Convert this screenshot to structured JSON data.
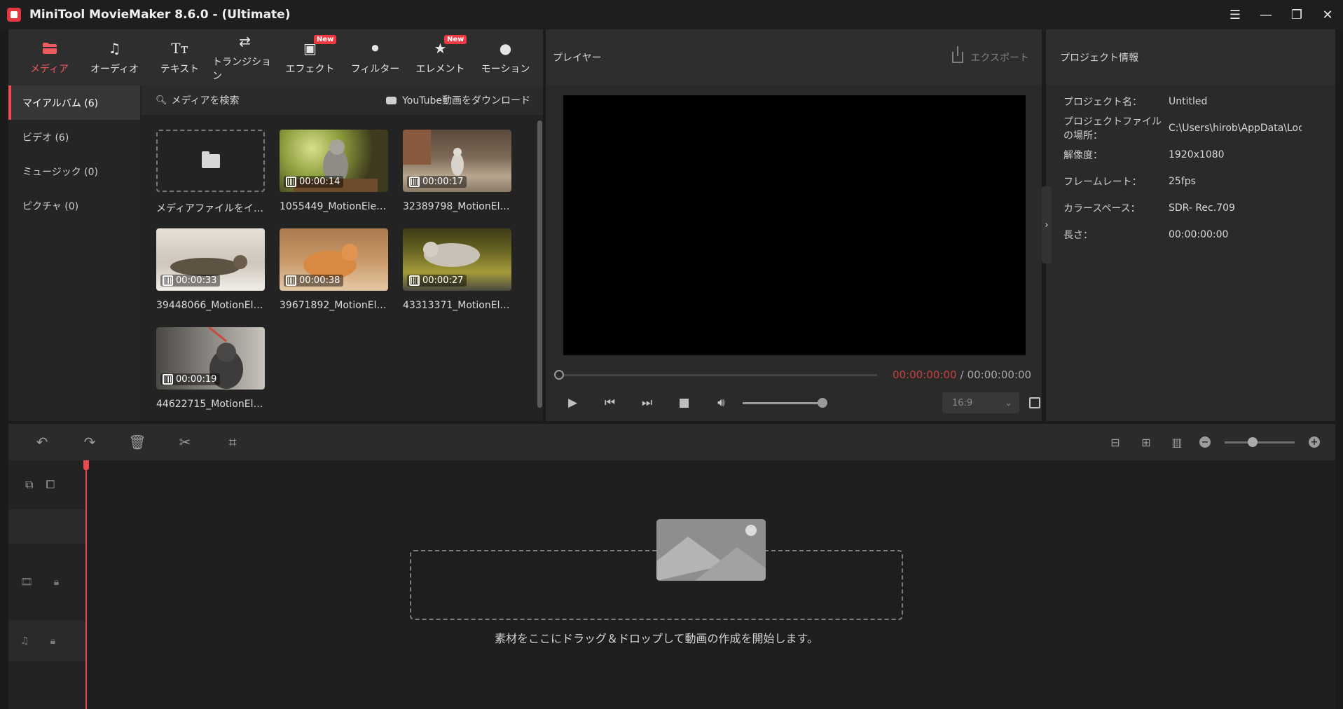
{
  "window": {
    "title": "MiniTool MovieMaker 8.6.0 - (Ultimate)",
    "controls": [
      "menu-icon",
      "minimize-icon",
      "maximize-icon",
      "close-icon"
    ]
  },
  "toolbar": {
    "items": [
      {
        "label": "メディア",
        "icon": "folder-icon",
        "active": true
      },
      {
        "label": "オーディオ",
        "icon": "music-note-icon"
      },
      {
        "label": "テキスト",
        "icon": "text-icon"
      },
      {
        "label": "トランジション",
        "icon": "transition-icon"
      },
      {
        "label": "エフェクト",
        "icon": "effect-icon",
        "badge": "New"
      },
      {
        "label": "フィルター",
        "icon": "filter-icon"
      },
      {
        "label": "エレメント",
        "icon": "element-icon",
        "badge": "New"
      },
      {
        "label": "モーション",
        "icon": "motion-icon"
      }
    ]
  },
  "sidebar": {
    "items": [
      {
        "label": "マイアルバム (6)",
        "active": true
      },
      {
        "label": "ビデオ (6)"
      },
      {
        "label": "ミュージック (0)"
      },
      {
        "label": "ピクチャ (0)"
      }
    ]
  },
  "media": {
    "search_label": "メディアを検索",
    "youtube_label": "YouTube動画をダウンロード",
    "import_label": "メディアファイルをインポート",
    "clips": [
      {
        "name": "1055449_MotionElem...",
        "duration": "00:00:14"
      },
      {
        "name": "32389798_MotionEle...",
        "duration": "00:00:17"
      },
      {
        "name": "39448066_MotionEle...",
        "duration": "00:00:33"
      },
      {
        "name": "39671892_MotionEle...",
        "duration": "00:00:38"
      },
      {
        "name": "43313371_MotionEle...",
        "duration": "00:00:27"
      },
      {
        "name": "44622715_MotionEle...",
        "duration": "00:00:19"
      }
    ]
  },
  "player": {
    "title": "プレイヤー",
    "export_label": "エクスポート",
    "current_time": "00:00:00:00",
    "separator": "/",
    "total_time": "00:00:00:00",
    "aspect_ratio": "16:9",
    "volume_level": 1.0,
    "progress_level": 0.0
  },
  "project_info": {
    "title": "プロジェクト情報",
    "rows": [
      {
        "label": "プロジェクト名：",
        "value": "Untitled"
      },
      {
        "label": "プロジェクトファイルの場所：",
        "value": "C:\\Users\\hirob\\AppData\\Loca"
      },
      {
        "label": "解像度：",
        "value": "1920x1080"
      },
      {
        "label": "フレームレート：",
        "value": "25fps"
      },
      {
        "label": "カラースペース：",
        "value": "SDR- Rec.709"
      },
      {
        "label": "長さ：",
        "value": "00:00:00:00"
      }
    ]
  },
  "timeline": {
    "drop_hint": "素材をここにドラッグ＆ドロップして動画の作成を開始します。",
    "zoom_level": 0.4
  },
  "colors": {
    "accent": "#ee4b52",
    "background": "#1b1b1b",
    "panel": "#2a2a2a"
  }
}
